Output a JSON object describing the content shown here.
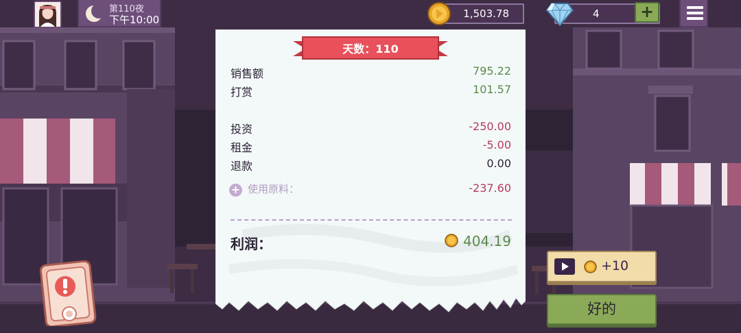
{
  "hud": {
    "day_label": "第110夜",
    "time_label": "下午10:00",
    "coins": "1,503.78",
    "gems": "4",
    "add_gems_label": "+"
  },
  "receipt": {
    "banner": "天数：110",
    "rows": [
      {
        "label": "销售额",
        "value": "795.22"
      },
      {
        "label": "打赏",
        "value": "101.57"
      },
      {
        "label": "投资",
        "value": "-250.00"
      },
      {
        "label": "租金",
        "value": "-5.00"
      },
      {
        "label": "退款",
        "value": "0.00"
      }
    ],
    "materials": {
      "label": "使用原料：",
      "value": "-237.60"
    },
    "profit": {
      "label": "利润：",
      "value": "404.19"
    }
  },
  "buttons": {
    "ad_reward": "+10",
    "ok": "好的"
  },
  "colors": {
    "positive": "#5b8a4c",
    "negative": "#b8395e",
    "banner": "#e8505b",
    "button_green": "#8aaa57",
    "panel_purple": "#6e4f7a"
  },
  "icons": [
    "moon-icon",
    "coin-icon",
    "diamond-icon",
    "menu-icon",
    "plus-icon",
    "play-video-icon",
    "alert-icon"
  ]
}
